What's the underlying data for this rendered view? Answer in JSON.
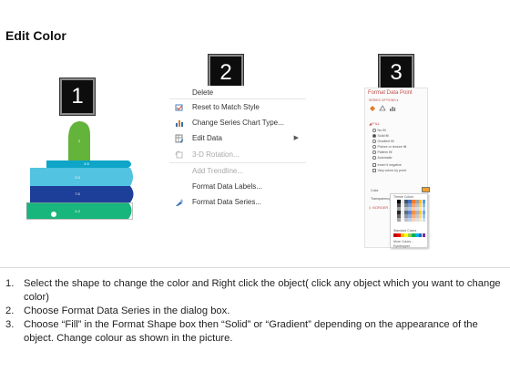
{
  "title": "Edit Color",
  "badges": [
    "1",
    "2",
    "3"
  ],
  "thumb_chart": {
    "labels": [
      "2",
      "4.5",
      "3.3",
      "7.5",
      "4.3"
    ],
    "colors": {
      "thumb": "#64b33b",
      "band1": "#0ea5c8",
      "band2": "#52c3e0",
      "band3": "#1d3f99",
      "band4": "#18b57d"
    }
  },
  "context_menu": {
    "items": [
      {
        "label": "Delete",
        "icon": "none",
        "disabled": false
      },
      {
        "label": "Reset to Match Style",
        "icon": "reset-style-icon",
        "disabled": false
      },
      {
        "label": "Change Series Chart Type...",
        "icon": "chart-type-icon",
        "disabled": false
      },
      {
        "label": "Edit Data",
        "icon": "edit-data-icon",
        "disabled": false,
        "submenu": true
      },
      {
        "label": "3-D Rotation...",
        "icon": "rotation-icon",
        "disabled": true
      },
      {
        "label": "Add Trendline...",
        "icon": "none",
        "disabled": true
      },
      {
        "label": "Format Data Labels...",
        "icon": "none",
        "disabled": false
      },
      {
        "label": "Format Data Series...",
        "icon": "format-series-icon",
        "disabled": false
      }
    ]
  },
  "format_pane": {
    "title": "Format Data Point",
    "subtitle": "SERIES OPTIONS ▾",
    "fill_section": "◢ FILL",
    "fill_options": [
      "No fill",
      "Solid fill",
      "Gradient fill",
      "Picture or texture fill",
      "Pattern fill",
      "Automatic"
    ],
    "checks": [
      "Invert if negative",
      "Vary colors by point"
    ],
    "color_label": "Color",
    "transparency_label": "Transparency",
    "border_section": "▷ BORDER",
    "palette": {
      "title": "Theme Colors",
      "standard_label": "Standard Colors",
      "more": "More Colors...",
      "eyedropper": "Eyedropper"
    }
  },
  "steps": [
    {
      "n": "1.",
      "text": "Select the shape to change the color and Right click the object( click any object which you want to change color)"
    },
    {
      "n": "2.",
      "text": "Choose Format Data Series in the dialog box."
    },
    {
      "n": "3.",
      "text": "Choose “Fill” in the Format Shape box then “Solid” or “Gradient” depending on the appearance of the object. Change colour as shown in the picture."
    }
  ]
}
